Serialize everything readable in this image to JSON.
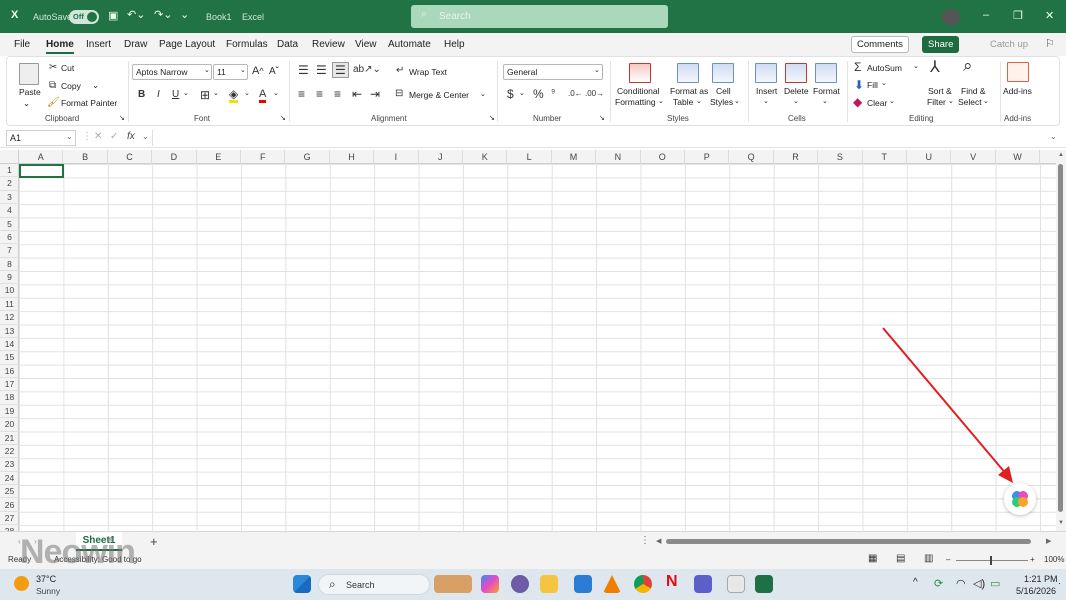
{
  "titlebar": {
    "autosave": "AutoSave",
    "toggle": "Off",
    "book": "Book1",
    "app": "Excel",
    "search": "Search"
  },
  "menu": {
    "tabs": [
      "File",
      "Home",
      "Insert",
      "Draw",
      "Page Layout",
      "Formulas",
      "Data",
      "Review",
      "View",
      "Automate",
      "Help"
    ],
    "comments": "Comments",
    "share": "Share",
    "catchup": "Catch up"
  },
  "ribbon": {
    "clipboard": {
      "paste": "Paste",
      "cut": "Cut",
      "copy": "Copy",
      "painter": "Format Painter",
      "group": "Clipboard"
    },
    "font": {
      "name": "Aptos Narrow",
      "size": "11",
      "group": "Font"
    },
    "alignment": {
      "wrap": "Wrap Text",
      "merge": "Merge & Center",
      "group": "Alignment"
    },
    "number": {
      "format": "General",
      "group": "Number"
    },
    "styles": {
      "cond1": "Conditional",
      "cond2": "Formatting",
      "table1": "Format as",
      "table2": "Table",
      "cell1": "Cell",
      "cell2": "Styles",
      "group": "Styles"
    },
    "cells": {
      "insert": "Insert",
      "delete": "Delete",
      "format": "Format",
      "group": "Cells"
    },
    "editing": {
      "autosum": "AutoSum",
      "fill": "Fill",
      "clear": "Clear",
      "sort1": "Sort &",
      "sort2": "Filter",
      "find1": "Find &",
      "find2": "Select",
      "group": "Editing"
    },
    "addins": {
      "label": "Add-ins",
      "group": "Add-ins"
    }
  },
  "formula": {
    "namebox": "A1",
    "fx": "fx"
  },
  "grid": {
    "columns": [
      "A",
      "B",
      "C",
      "D",
      "E",
      "F",
      "G",
      "H",
      "I",
      "J",
      "K",
      "L",
      "M",
      "N",
      "O",
      "P",
      "Q",
      "R",
      "S",
      "T",
      "U",
      "V",
      "W"
    ],
    "rows": [
      "1",
      "2",
      "3",
      "4",
      "5",
      "6",
      "7",
      "8",
      "9",
      "10",
      "11",
      "12",
      "13",
      "14",
      "15",
      "16",
      "17",
      "18",
      "19",
      "20",
      "21",
      "22",
      "23",
      "24",
      "25",
      "26",
      "27",
      "28"
    ]
  },
  "sheets": {
    "tab": "Sheet1",
    "add": "+"
  },
  "status": {
    "ready": "Ready",
    "access": "Accessibility: Good to go",
    "zoom": "100%"
  },
  "taskbar": {
    "temp": "37°C",
    "weather": "Sunny",
    "search": "Search",
    "time": "1:21 PM",
    "date": "5/16/2026"
  },
  "watermark": "Neowin"
}
